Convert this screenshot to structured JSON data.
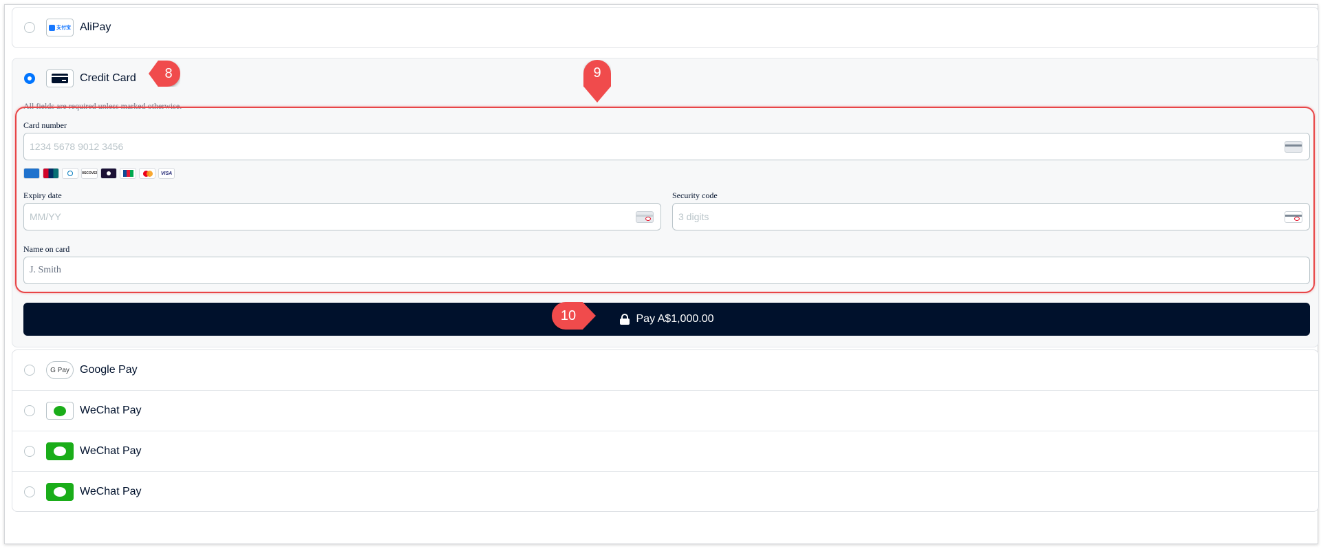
{
  "payment_methods": {
    "alipay": {
      "label": "AliPay",
      "logo_text": "支付宝"
    },
    "credit_card": {
      "label": "Credit Card"
    },
    "google_pay": {
      "label": "Google Pay",
      "logo_text": "G Pay"
    },
    "wechat_1": {
      "label": "WeChat Pay"
    },
    "wechat_2": {
      "label": "WeChat Pay"
    },
    "wechat_3": {
      "label": "WeChat Pay"
    }
  },
  "form": {
    "required_note": "All fields are required unless marked otherwise.",
    "card_number": {
      "label": "Card number",
      "placeholder": "1234 5678 9012 3456"
    },
    "expiry": {
      "label": "Expiry date",
      "placeholder": "MM/YY"
    },
    "security": {
      "label": "Security code",
      "placeholder": "3 digits"
    },
    "name": {
      "label": "Name on card",
      "placeholder": "J. Smith"
    },
    "brands": [
      "AMEX",
      "UnionPay",
      "Diners",
      "DISCOVER",
      "elo",
      "JCB",
      "Mastercard",
      "VISA"
    ]
  },
  "pay_button": {
    "label": "Pay A$1,000.00"
  },
  "annotations": {
    "m8": "8",
    "m9": "9",
    "m10": "10"
  },
  "colors": {
    "accent": "#0075ff",
    "primary": "#00112c",
    "annotation": "#f04b4c",
    "wechat_green": "#1aad19"
  }
}
